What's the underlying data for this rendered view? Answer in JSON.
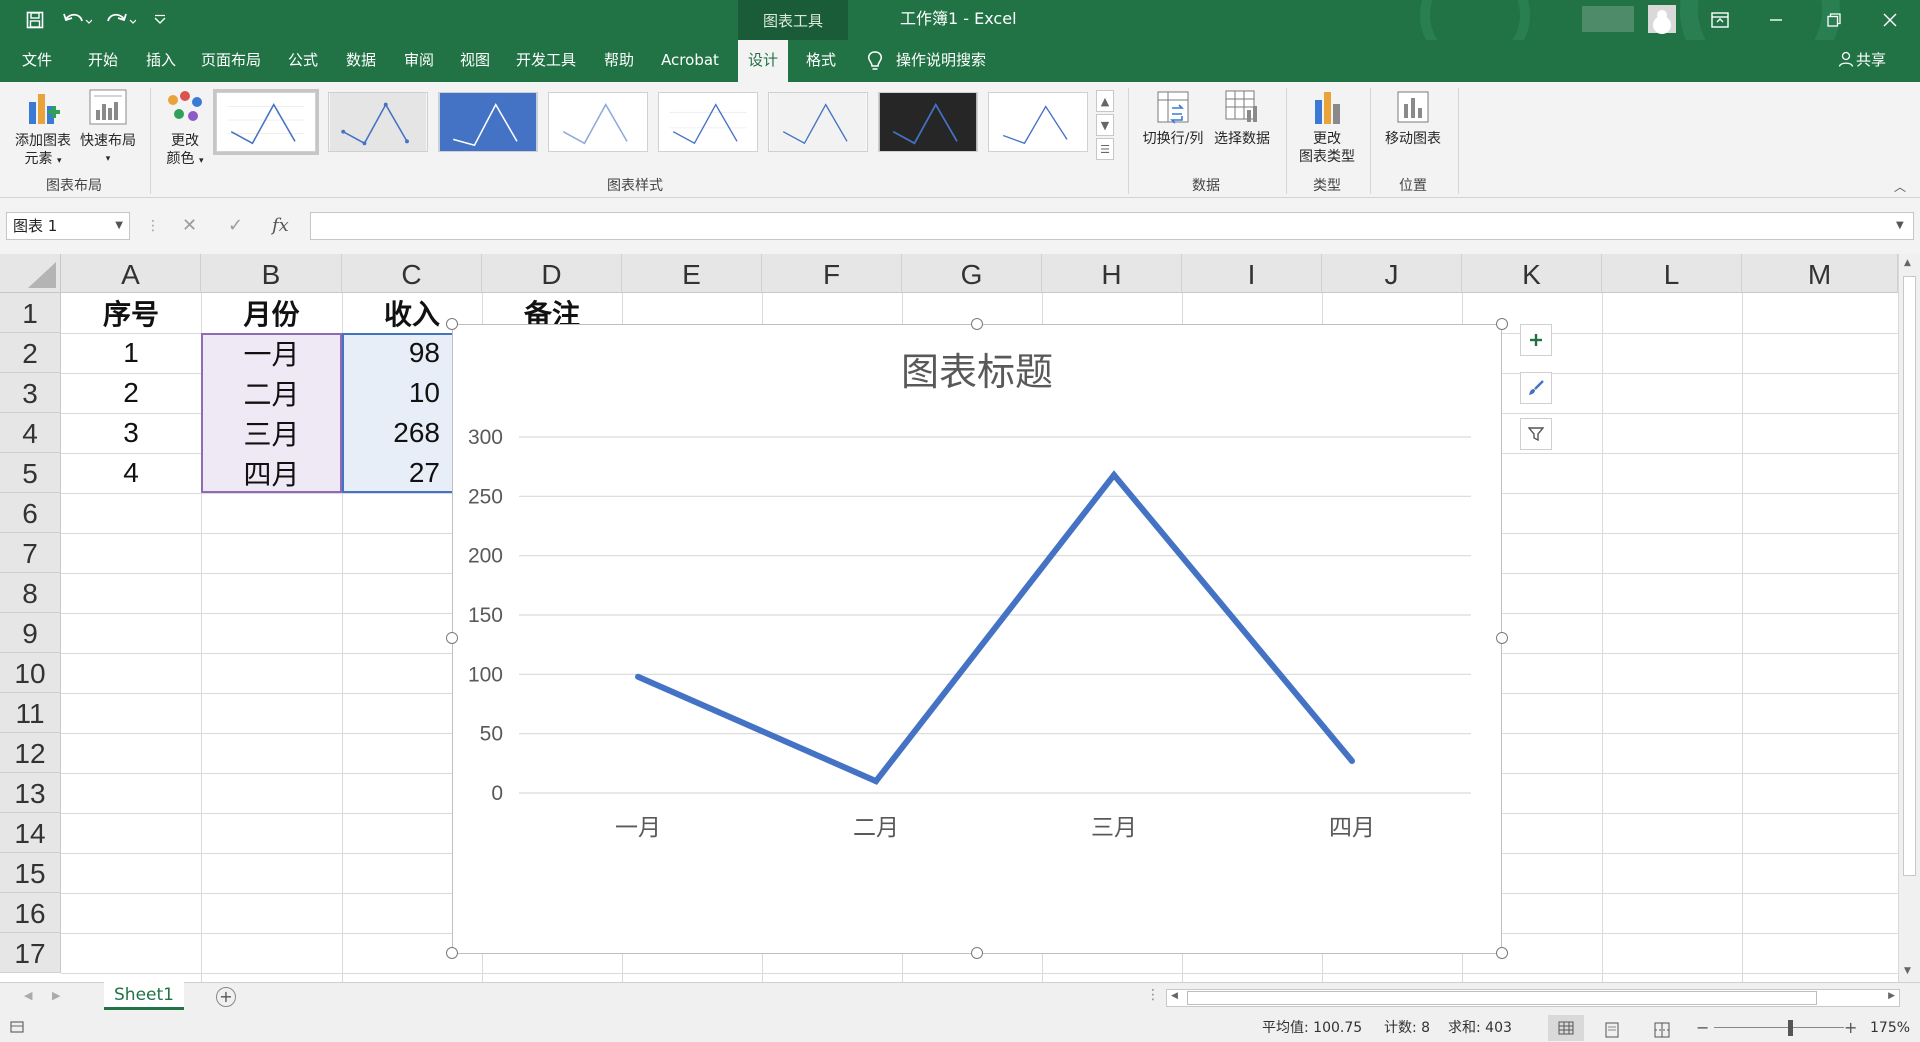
{
  "window": {
    "title": "工作簿1  -  Excel",
    "context_tab": "图表工具"
  },
  "tabs": [
    "文件",
    "开始",
    "插入",
    "页面布局",
    "公式",
    "数据",
    "审阅",
    "视图",
    "开发工具",
    "帮助",
    "Acrobat",
    "设计",
    "格式"
  ],
  "active_tab": "设计",
  "tell_me": "操作说明搜索",
  "share": "共享",
  "ribbon": {
    "add_element": [
      "添加图表",
      "元素"
    ],
    "quick_layout": "快速布局",
    "change_colors": [
      "更改",
      "颜色"
    ],
    "group_layout": "图表布局",
    "group_styles": "图表样式",
    "switch_row_col": "切换行/列",
    "select_data": "选择数据",
    "group_data": "数据",
    "change_type": [
      "更改",
      "图表类型"
    ],
    "group_type": "类型",
    "move_chart": "移动图表",
    "group_location": "位置"
  },
  "formula_bar": {
    "name_box": "图表 1",
    "fx": "fx",
    "value": ""
  },
  "sheet": {
    "columns": [
      "A",
      "B",
      "C",
      "D",
      "E",
      "F",
      "G",
      "H",
      "I",
      "J",
      "K",
      "L",
      "M"
    ],
    "rows": [
      "1",
      "2",
      "3",
      "4",
      "5",
      "6",
      "7",
      "8",
      "9",
      "10",
      "11",
      "12",
      "13",
      "14",
      "15",
      "16",
      "17"
    ],
    "headers": [
      "序号",
      "月份",
      "收入",
      "备注"
    ],
    "data": [
      [
        "1",
        "一月",
        "98"
      ],
      [
        "2",
        "二月",
        "10"
      ],
      [
        "3",
        "三月",
        "268"
      ],
      [
        "4",
        "四月",
        "27"
      ]
    ],
    "tab": "Sheet1",
    "add_sheet": "+"
  },
  "chart_data": {
    "type": "line",
    "title": "图表标题",
    "categories": [
      "一月",
      "二月",
      "三月",
      "四月"
    ],
    "series": [
      {
        "values": [
          98,
          10,
          268,
          27
        ],
        "color": "#4472c4"
      }
    ],
    "ylim": [
      0,
      300
    ],
    "yticks": [
      0,
      50,
      100,
      150,
      200,
      250,
      300
    ],
    "grid": true,
    "legend": "none"
  },
  "status": {
    "average": "平均值: 100.75",
    "count": "计数: 8",
    "sum": "求和: 403",
    "zoom": "175%"
  },
  "colors": {
    "excel_green": "#217346",
    "series_blue": "#4472c4"
  }
}
